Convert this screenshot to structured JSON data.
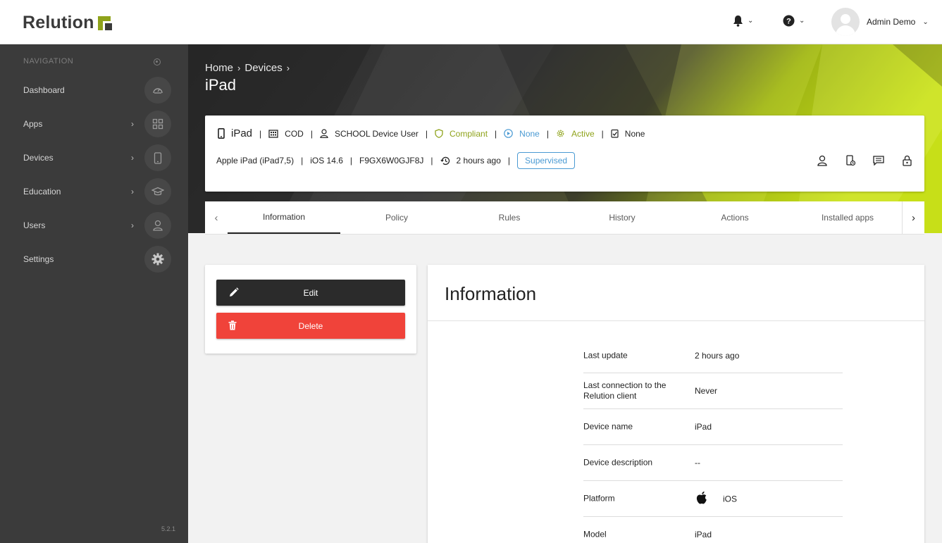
{
  "app": {
    "logo_text": "Relution"
  },
  "header": {
    "user_name": "Admin Demo",
    "notifications_icon": "bell-icon",
    "help_icon": "help-icon"
  },
  "sidebar": {
    "heading": "NAVIGATION",
    "items": [
      {
        "label": "Dashboard",
        "icon": "dashboard-icon",
        "has_children": false
      },
      {
        "label": "Apps",
        "icon": "apps-grid-icon",
        "has_children": true
      },
      {
        "label": "Devices",
        "icon": "phone-icon",
        "has_children": true
      },
      {
        "label": "Education",
        "icon": "graduation-cap-icon",
        "has_children": true
      },
      {
        "label": "Users",
        "icon": "user-icon",
        "has_children": true
      },
      {
        "label": "Settings",
        "icon": "gear-icon",
        "has_children": false
      }
    ],
    "version": "5.2.1"
  },
  "breadcrumb": {
    "home": "Home",
    "devices": "Devices"
  },
  "page": {
    "title": "iPad"
  },
  "device_summary": {
    "name": "iPad",
    "ownership": "COD",
    "user": "SCHOOL Device User",
    "compliance": "Compliant",
    "enrollment": "None",
    "status": "Active",
    "policy": "None",
    "model": "Apple iPad (iPad7,5)",
    "os": "iOS 14.6",
    "serial": "F9GX6W0GJF8J",
    "last_seen": "2 hours ago",
    "badge": "Supervised"
  },
  "tabs": [
    "Information",
    "Policy",
    "Rules",
    "History",
    "Actions",
    "Installed apps"
  ],
  "active_tab": "Information",
  "actions": {
    "edit_label": "Edit",
    "delete_label": "Delete"
  },
  "info": {
    "title": "Information",
    "rows": [
      {
        "label": "Last update",
        "value": "2 hours ago"
      },
      {
        "label": "Last connection to the Relution client",
        "value": "Never"
      },
      {
        "label": "Device name",
        "value": "iPad"
      },
      {
        "label": "Device description",
        "value": "--"
      },
      {
        "label": "Platform",
        "value": "iOS",
        "icon": "apple-icon"
      },
      {
        "label": "Model",
        "value": "iPad"
      }
    ]
  },
  "colors": {
    "brand_green": "#8fa31b",
    "link_blue": "#4a9ad3",
    "delete_red": "#f0433a",
    "sidebar_bg": "#3b3b3b"
  }
}
